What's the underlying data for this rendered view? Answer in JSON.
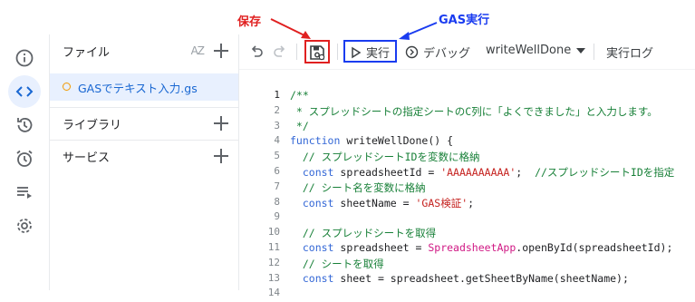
{
  "annotations": {
    "save_label": "保存",
    "run_label": "GAS実行",
    "red": "#e02020",
    "blue": "#1a3cf0"
  },
  "rail": {
    "icons": [
      "info-icon",
      "code-icon",
      "history-icon",
      "alarm-icon",
      "executions-icon",
      "settings-icon"
    ],
    "active": "code-icon"
  },
  "sidebar": {
    "files_label": "ファイル",
    "sort_glyph": "AZ",
    "active_file": "GASでテキスト入力.gs",
    "libraries_label": "ライブラリ",
    "services_label": "サービス"
  },
  "toolbar": {
    "run_label": "実行",
    "debug_label": "デバッグ",
    "function_name": "writeWellDone",
    "log_label": "実行ログ"
  },
  "editor": {
    "lines": [
      {
        "n": "1",
        "html": "<span class='c-comment'>/**</span>"
      },
      {
        "n": "2",
        "html": "<span class='c-comment'> * スプレッドシートの指定シートのC列に「よくできました」と入力します。</span>"
      },
      {
        "n": "3",
        "html": "<span class='c-comment'> */</span>"
      },
      {
        "n": "4",
        "html": "<span class='c-kw'>function</span> writeWellDone() {"
      },
      {
        "n": "5",
        "html": "  <span class='c-comment'>// スプレッドシートIDを変数に格納</span>"
      },
      {
        "n": "6",
        "html": "  <span class='c-kw'>const</span> spreadsheetId = <span class='c-str'>'AAAAAAAAAA'</span>;  <span class='c-comment'>//スプレッドシートIDを指定</span>"
      },
      {
        "n": "7",
        "html": "  <span class='c-comment'>// シート名を変数に格納</span>"
      },
      {
        "n": "8",
        "html": "  <span class='c-kw'>const</span> sheetName = <span class='c-str'>'GAS検証'</span>;"
      },
      {
        "n": "9",
        "html": ""
      },
      {
        "n": "10",
        "html": "  <span class='c-comment'>// スプレッドシートを取得</span>"
      },
      {
        "n": "11",
        "html": "  <span class='c-kw'>const</span> spreadsheet = <span class='c-cls'>SpreadsheetApp</span>.openById(spreadsheetId);"
      },
      {
        "n": "12",
        "html": "  <span class='c-comment'>// シートを取得</span>"
      },
      {
        "n": "13",
        "html": "  <span class='c-kw'>const</span> sheet = spreadsheet.getSheetByName(sheetName);"
      },
      {
        "n": "14",
        "html": ""
      }
    ]
  }
}
